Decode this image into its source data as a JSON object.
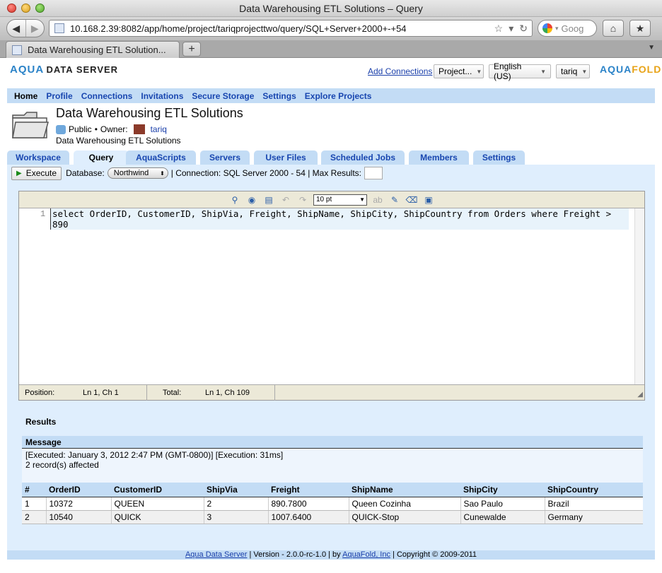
{
  "window": {
    "title": "Data Warehousing ETL Solutions – Query",
    "url": "10.168.2.39:8082/app/home/project/tariqprojecttwo/query/SQL+Server+2000+-+54",
    "search_placeholder": "Goog",
    "tab_title": "Data Warehousing ETL Solution...",
    "newtab_label": "+"
  },
  "header": {
    "logo_aqua": "AQUA",
    "logo_rest": "DATA SERVER",
    "logo_right_a": "AQUA",
    "logo_right_b": "FOLD",
    "add_connections": "Add Connections",
    "project_dd": "Project...",
    "lang_dd": "English (US)",
    "user_dd": "tariq"
  },
  "mainnav": [
    "Home",
    "Profile",
    "Connections",
    "Invitations",
    "Secure Storage",
    "Settings",
    "Explore Projects"
  ],
  "project": {
    "title": "Data Warehousing ETL Solutions",
    "visibility": "Public",
    "owner_label": "Owner:",
    "owner": "tariq",
    "description": "Data Warehousing ETL Solutions"
  },
  "tabs": [
    "Workspace",
    "Query",
    "AquaScripts",
    "Servers",
    "User Files",
    "Scheduled Jobs",
    "Members",
    "Settings"
  ],
  "querybar": {
    "execute": "Execute",
    "database_label": "Database:",
    "database": "Northwind",
    "connection_text": "| Connection: SQL Server 2000 - 54 | Max Results:"
  },
  "editor": {
    "font_size": "10 pt",
    "line_number": "1",
    "sql": "select OrderID, CustomerID, ShipVia, Freight, ShipName, ShipCity, ShipCountry from Orders where Freight > 890",
    "position_label": "Position:",
    "position": "Ln 1, Ch 1",
    "total_label": "Total:",
    "total": "Ln 1, Ch 109"
  },
  "results": {
    "heading": "Results",
    "message_heading": "Message",
    "message_line1": "[Executed: January 3, 2012 2:47 PM (GMT-0800)] [Execution: 31ms]",
    "message_line2": "2 record(s) affected",
    "columns": [
      "#",
      "OrderID",
      "CustomerID",
      "ShipVia",
      "Freight",
      "ShipName",
      "ShipCity",
      "ShipCountry"
    ],
    "rows": [
      [
        "1",
        "10372",
        "QUEEN",
        "2",
        "890.7800",
        "Queen Cozinha",
        "Sao Paulo",
        "Brazil"
      ],
      [
        "2",
        "10540",
        "QUICK",
        "3",
        "1007.6400",
        "QUICK-Stop",
        "Cunewalde",
        "Germany"
      ]
    ]
  },
  "footer": {
    "link1": "Aqua Data Server",
    "text1": " | Version - 2.0.0-rc-1.0 | by ",
    "link2": "AquaFold, Inc",
    "text2": " | Copyright © 2009-2011"
  }
}
